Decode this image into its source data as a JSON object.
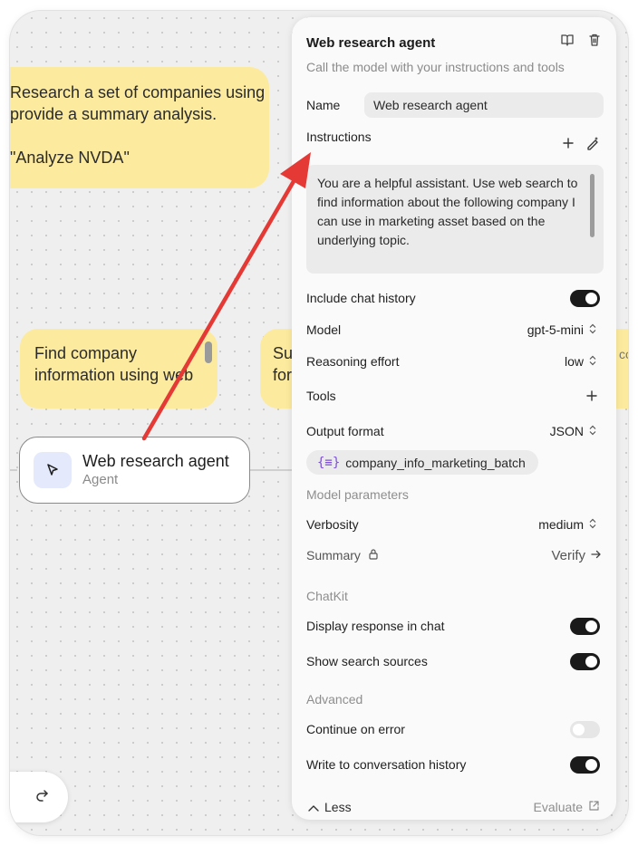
{
  "canvas": {
    "note_main_lines": [
      "Research a set of companies using",
      "provide a summary analysis.",
      "",
      "\"Analyze NVDA\""
    ],
    "note_find": "Find company information using web",
    "note_su": "Su for",
    "note_right": "co",
    "agent_node": {
      "title": "Web research agent",
      "subtitle": "Agent"
    }
  },
  "panel": {
    "title": "Web research agent",
    "subtitle": "Call the model with your instructions and tools",
    "name_label": "Name",
    "name_value": "Web research agent",
    "instructions_label": "Instructions",
    "instructions_text": "You are a helpful assistant. Use web search to find information about the following company I can use in marketing asset based on the underlying topic.",
    "include_chat_history_label": "Include chat history",
    "include_chat_history": true,
    "model_label": "Model",
    "model_value": "gpt-5-mini",
    "reasoning_label": "Reasoning effort",
    "reasoning_value": "low",
    "tools_label": "Tools",
    "output_format_label": "Output format",
    "output_format_value": "JSON",
    "schema_name": "company_info_marketing_batch",
    "model_params_header": "Model parameters",
    "verbosity_label": "Verbosity",
    "verbosity_value": "medium",
    "summary_label": "Summary",
    "verify_label": "Verify",
    "chatkit_header": "ChatKit",
    "display_response_label": "Display response in chat",
    "display_response": true,
    "show_sources_label": "Show search sources",
    "show_sources": true,
    "advanced_header": "Advanced",
    "continue_on_error_label": "Continue on error",
    "continue_on_error": false,
    "write_history_label": "Write to conversation history",
    "write_history": true,
    "less_label": "Less",
    "evaluate_label": "Evaluate"
  },
  "colors": {
    "note": "#fcea9e",
    "arrow": "#e53935",
    "toggle_on": "#1a1a1a",
    "agent_icon_bg": "#e4eafc"
  }
}
